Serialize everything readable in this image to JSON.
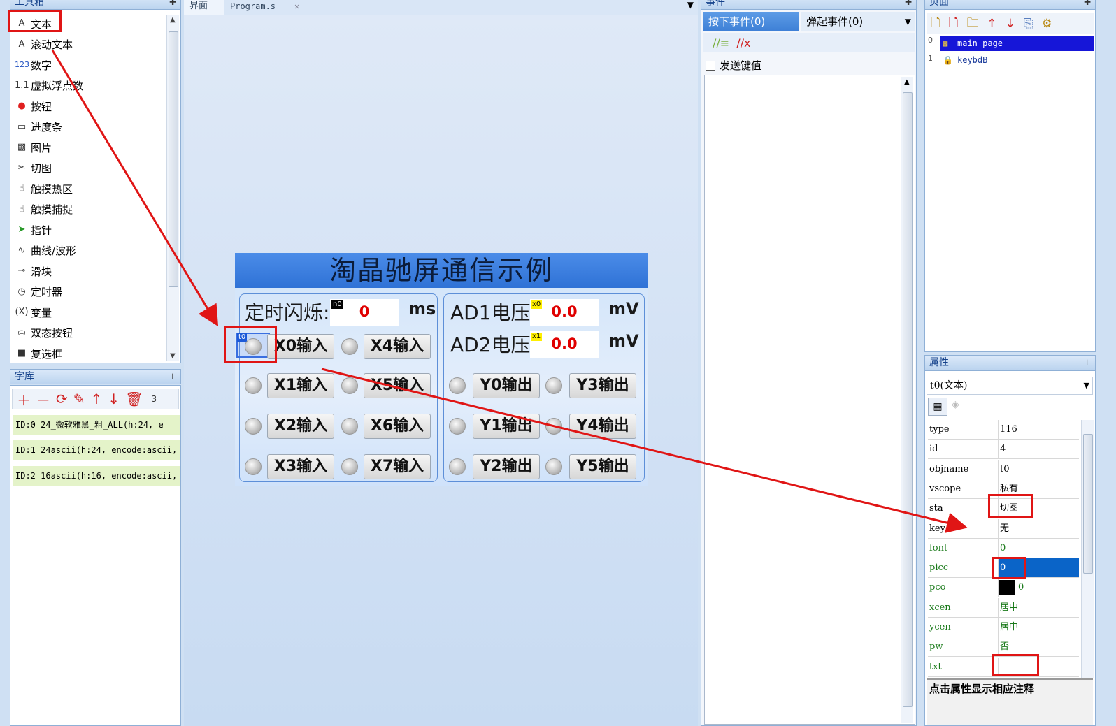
{
  "toolbox": {
    "title": "工具箱",
    "items": [
      {
        "label": "文本",
        "icon": "text-A-icon"
      },
      {
        "label": "滚动文本",
        "icon": "scroll-text-icon"
      },
      {
        "label": "数字",
        "icon": "number-123-icon"
      },
      {
        "label": "虚拟浮点数",
        "icon": "float-icon"
      },
      {
        "label": "按钮",
        "icon": "button-icon"
      },
      {
        "label": "进度条",
        "icon": "progress-icon"
      },
      {
        "label": "图片",
        "icon": "picture-icon"
      },
      {
        "label": "切图",
        "icon": "scissors-icon"
      },
      {
        "label": "触摸热区",
        "icon": "hand-icon"
      },
      {
        "label": "触摸捕捉",
        "icon": "hand-capture-icon"
      },
      {
        "label": "指针",
        "icon": "pointer-icon"
      },
      {
        "label": "曲线/波形",
        "icon": "wave-icon"
      },
      {
        "label": "滑块",
        "icon": "slider-icon"
      },
      {
        "label": "定时器",
        "icon": "timer-icon"
      },
      {
        "label": "变量",
        "icon": "variable-icon"
      },
      {
        "label": "双态按钮",
        "icon": "dual-state-button-icon"
      },
      {
        "label": "复选框",
        "icon": "checkbox-icon"
      }
    ]
  },
  "fonts": {
    "title": "字库",
    "count": "3",
    "rows": [
      "ID:0   24_微软雅黑_粗_ALL(h:24, e",
      "ID:1   24ascii(h:24, encode:ascii,",
      "ID:2   16ascii(h:16, encode:ascii,"
    ]
  },
  "editor": {
    "tabs": [
      "界面",
      "Program.s"
    ],
    "close_glyph": "✕"
  },
  "hmi": {
    "title": "淘晶驰屏通信示例",
    "blink_label": "定时闪烁:",
    "blink_tag": "n0",
    "blink_value": "0",
    "blink_unit": "ms",
    "ad1_label": "AD1电压:",
    "ad1_tag": "x0",
    "ad1_value": "0.0",
    "ad1_unit": "mV",
    "ad2_label": "AD2电压:",
    "ad2_tag": "x1",
    "ad2_value": "0.0",
    "ad2_unit": "mV",
    "t0_tag": "t0",
    "inputs": [
      "X0输入",
      "X1输入",
      "X2输入",
      "X3输入",
      "X4输入",
      "X5输入",
      "X6输入",
      "X7输入"
    ],
    "outputs": [
      "Y0输出",
      "Y1输出",
      "Y2输出",
      "Y3输出",
      "Y4输出",
      "Y5输出"
    ]
  },
  "events": {
    "title": "事件",
    "press_tab": "按下事件(0)",
    "release_tab": "弹起事件(0)",
    "send_key_label": "发送键值"
  },
  "pages": {
    "title": "页面",
    "items": [
      {
        "index": "0",
        "name": "main_page"
      },
      {
        "index": "1",
        "name": "keybdB"
      }
    ]
  },
  "props": {
    "title": "属性",
    "object": "t0(文本)",
    "rows": [
      {
        "k": "type",
        "v": "116"
      },
      {
        "k": "id",
        "v": "4"
      },
      {
        "k": "objname",
        "v": "t0"
      },
      {
        "k": "vscope",
        "v": "私有"
      },
      {
        "k": "sta",
        "v": "切图"
      },
      {
        "k": "key",
        "v": "无"
      },
      {
        "k": "font",
        "v": "0"
      },
      {
        "k": "picc",
        "v": "0"
      },
      {
        "k": "pco",
        "v": "0"
      },
      {
        "k": "xcen",
        "v": "居中"
      },
      {
        "k": "ycen",
        "v": "居中"
      },
      {
        "k": "pw",
        "v": "否"
      },
      {
        "k": "txt",
        "v": ""
      }
    ],
    "hint": "点击属性显示相应注释"
  },
  "colors": {
    "accent_red": "#e01515",
    "selection_blue": "#0a64c8",
    "green_key": "#1a7a1a"
  }
}
